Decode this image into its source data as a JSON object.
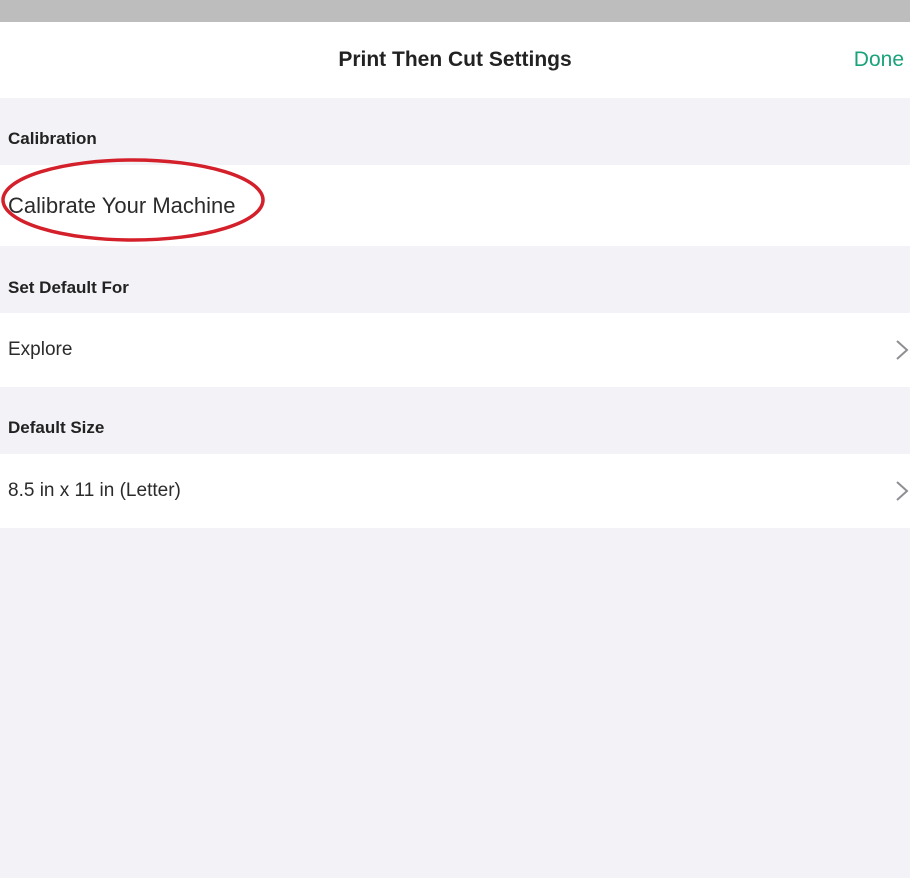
{
  "header": {
    "title": "Print Then Cut Settings",
    "done_label": "Done"
  },
  "sections": {
    "calibration": {
      "header": "Calibration",
      "row_label": "Calibrate Your Machine"
    },
    "set_default_for": {
      "header": "Set Default For",
      "row_label": "Explore"
    },
    "default_size": {
      "header": "Default Size",
      "row_label": "8.5 in x 11 in (Letter)"
    }
  },
  "icons": {
    "chevron": "chevron-right-icon"
  },
  "colors": {
    "accent": "#1aa37a",
    "annotation": "#d4202a",
    "background": "#f2f2f7"
  }
}
